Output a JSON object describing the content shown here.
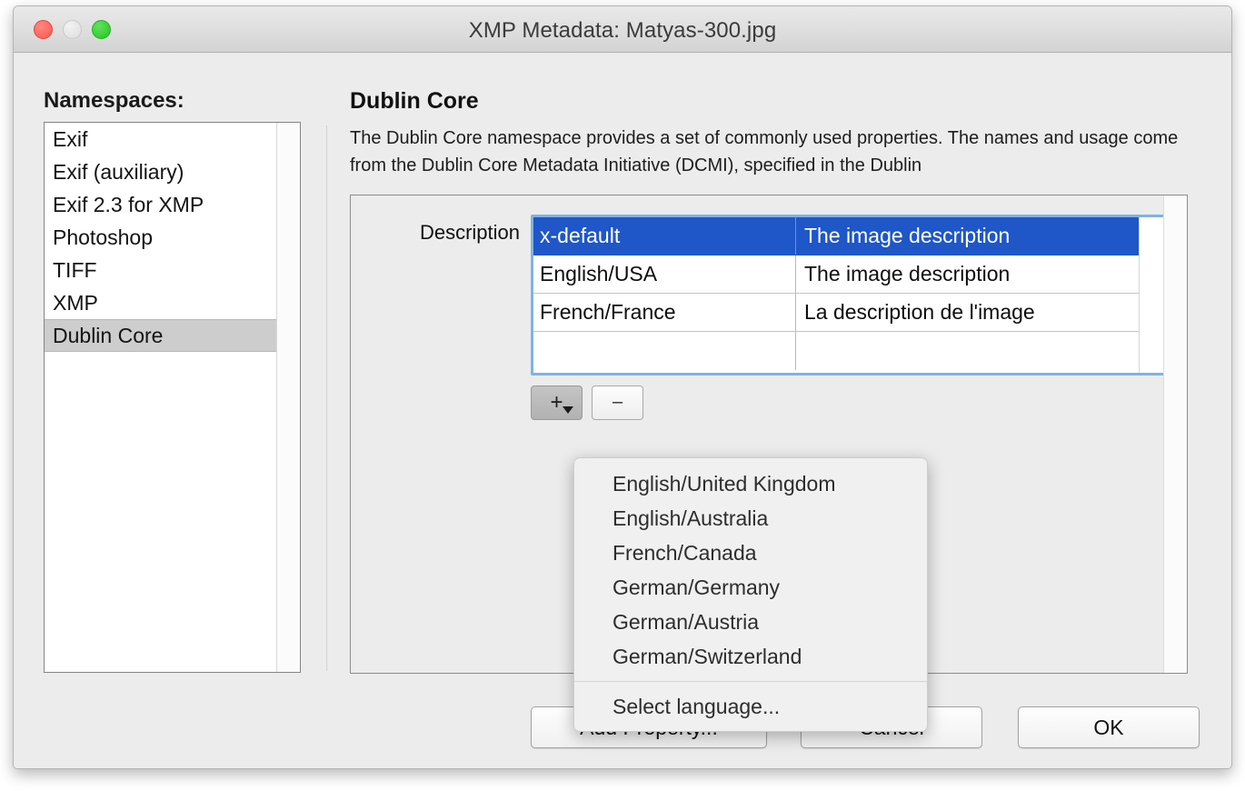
{
  "window": {
    "title": "XMP Metadata: Matyas-300.jpg",
    "traffic_lights": [
      "close-button",
      "minimize-button",
      "zoom-button"
    ]
  },
  "sidebar": {
    "heading": "Namespaces:",
    "items": [
      {
        "label": "Exif",
        "selected": false
      },
      {
        "label": "Exif (auxiliary)",
        "selected": false
      },
      {
        "label": "Exif 2.3 for XMP",
        "selected": false
      },
      {
        "label": "Photoshop",
        "selected": false
      },
      {
        "label": "TIFF",
        "selected": false
      },
      {
        "label": "XMP",
        "selected": false
      },
      {
        "label": "Dublin Core",
        "selected": true
      }
    ]
  },
  "detail": {
    "title": "Dublin Core",
    "description": "The Dublin Core namespace provides a set of commonly used properties. The names and usage come from the Dublin Core Metadata Initiative (DCMI), specified in the Dublin",
    "property_label": "Description",
    "table": {
      "rows": [
        {
          "language": "x-default",
          "value": "The image description",
          "selected": true
        },
        {
          "language": "English/USA",
          "value": "The image description",
          "selected": false
        },
        {
          "language": "French/France",
          "value": "La description de l'image",
          "selected": false
        },
        {
          "language": "",
          "value": "",
          "selected": false
        }
      ]
    },
    "add_button_label": "+",
    "remove_button_label": "–"
  },
  "language_menu": {
    "items": [
      "English/United Kingdom",
      "English/Australia",
      "French/Canada",
      "German/Germany",
      "German/Austria",
      "German/Switzerland"
    ],
    "footer_item": "Select language..."
  },
  "footer": {
    "add_property_label": "Add Property...",
    "cancel_label": "Cancel",
    "ok_label": "OK"
  },
  "colors": {
    "selection_blue": "#1f56c8",
    "sidebar_selection_gray": "#cdcdcd",
    "window_background": "#ececec",
    "focus_ring": "#7fb2e8"
  }
}
